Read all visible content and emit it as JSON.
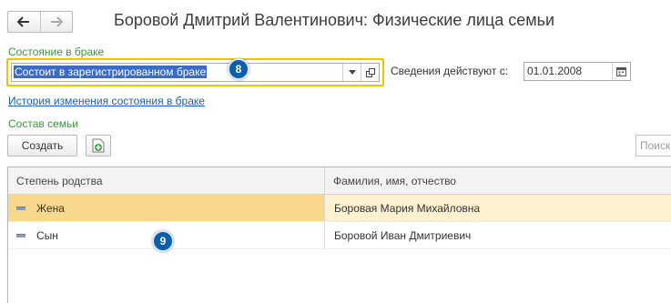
{
  "window": {
    "title": "Боровой Дмитрий Валентинович: Физические лица семьи",
    "back_icon": "arrow-left-icon",
    "forward_icon": "arrow-right-icon"
  },
  "marital": {
    "label": "Состояние в браке",
    "value": "Состоит в зарегистрированном браке",
    "history_link": "История изменения состояния в браке"
  },
  "effective": {
    "label": "Сведения действуют с:",
    "date": "01.01.2008"
  },
  "family": {
    "label": "Состав семьи",
    "create_button": "Создать",
    "search_placeholder": "Поиск",
    "columns": [
      "Степень родства",
      "Фамилия, имя, отчество"
    ],
    "rows": [
      {
        "relation": "Жена",
        "name": "Боровая Мария Михайловна",
        "selected": true
      },
      {
        "relation": "Сын",
        "name": "Боровой Иван Дмитриевич",
        "selected": false
      }
    ]
  },
  "callouts": {
    "first": "8",
    "second": "9"
  },
  "colors": {
    "accent_link": "#1a5fb4",
    "label_green": "#3a9a3a",
    "focus_border": "#f2c300",
    "selected_row": "#f8d98b",
    "callout": "#0c5fad"
  }
}
